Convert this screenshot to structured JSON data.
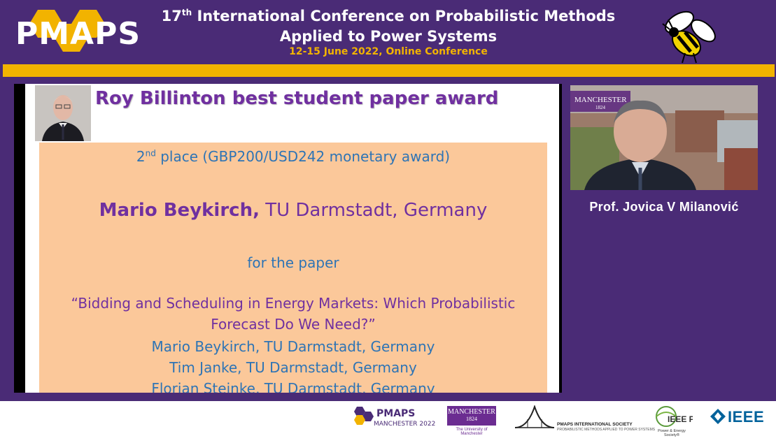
{
  "header": {
    "logo_text": "PMAPS",
    "title_line1_ordinal": "17",
    "title_line1_suffix": "th",
    "title_line1_rest": " International Conference on Probabilistic Methods",
    "title_line2": "Applied to Power Systems",
    "subtitle": "12-15 June 2022, Online Conference"
  },
  "slide": {
    "title": "Roy Billinton best student paper award",
    "place_num": "2",
    "place_suffix": "nd",
    "place_rest": " place (GBP200/USD242 monetary award)",
    "winner_name": "Mario Beykirch,",
    "winner_affil": " TU Darmstadt, Germany",
    "for_paper": "for the paper",
    "paper_title_line1": "“Bidding and Scheduling in Energy Markets: Which Probabilistic",
    "paper_title_line2": "Forecast Do We Need?”",
    "authors": [
      "Mario Beykirch, TU Darmstadt, Germany",
      "Tim Janke, TU Darmstadt, Germany",
      "Florian Steinke, TU Darmstadt, Germany"
    ]
  },
  "speaker": {
    "name": "Prof. Jovica V Milanović",
    "video_overlay_text": "MANCHESTER",
    "video_overlay_year": "1824"
  },
  "footer": {
    "pmaps_logo_text": "PMAPS",
    "pmaps_logo_sub": "MANCHESTER 2022",
    "manchester_logo_text": "MANCHESTER",
    "manchester_logo_year": "1824",
    "manchester_logo_sub": "The University of Manchester",
    "society_name": "PMAPS INTERNATIONAL SOCIETY",
    "society_sub": "PROBABILISTIC METHODS APPLIED TO POWER SYSTEMS",
    "pes_text": "IEEE PES",
    "pes_sub": "Power & Energy Society®",
    "ieee_text": "IEEE"
  },
  "colors": {
    "frame_purple": "#4a2b76",
    "accent_gold": "#f2b300",
    "slide_purple": "#7030a0",
    "slide_blue": "#2e74b5",
    "peach_box": "#fbc89a"
  }
}
